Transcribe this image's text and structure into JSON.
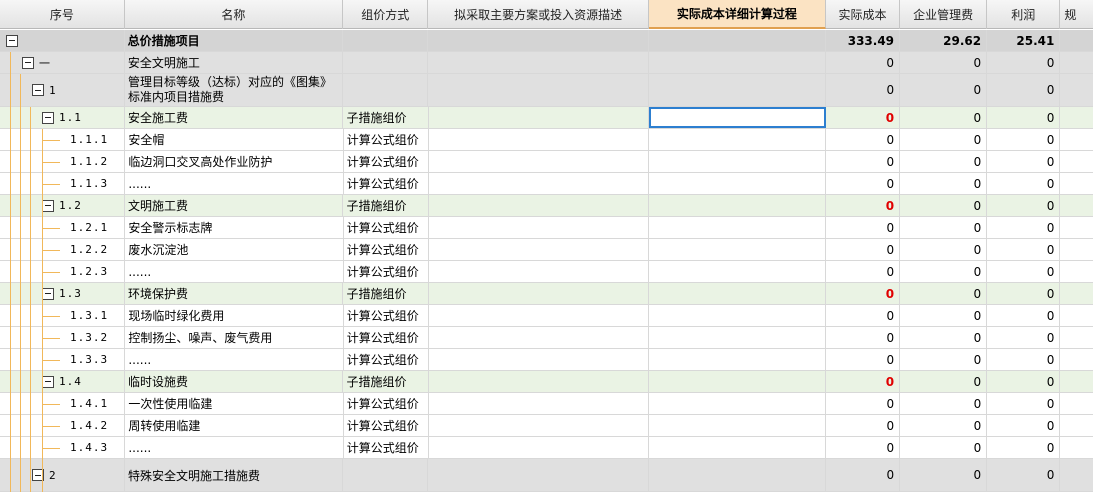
{
  "columns": [
    "序号",
    "名称",
    "组价方式",
    "拟采取主要方案或投入资源描述",
    "实际成本详细计算过程",
    "实际成本",
    "企业管理费",
    "利润",
    "规"
  ],
  "rows": [
    {
      "type": "total",
      "seq": "",
      "name": "总价措施项目",
      "method": "",
      "desc": "",
      "calc": "",
      "cost": "333.49",
      "mgmt": "29.62",
      "profit": "25.41"
    },
    {
      "type": "lvl1",
      "seq": "一",
      "name": "安全文明施工",
      "method": "",
      "desc": "",
      "calc": "",
      "cost": "0",
      "mgmt": "0",
      "profit": "0"
    },
    {
      "type": "lvl2",
      "seq": "1",
      "name": "管理目标等级（达标）对应的《图集》标准内项目措施费",
      "method": "",
      "desc": "",
      "calc": "",
      "cost": "0",
      "mgmt": "0",
      "profit": "0"
    },
    {
      "type": "sub",
      "seq": "1.1",
      "name": "安全施工费",
      "method": "子措施组价",
      "desc": "",
      "calc": "",
      "cost": "0",
      "mgmt": "0",
      "profit": "0"
    },
    {
      "type": "item",
      "seq": "1.1.1",
      "name": "安全帽",
      "method": "计算公式组价",
      "desc": "",
      "calc": "",
      "cost": "0",
      "mgmt": "0",
      "profit": "0"
    },
    {
      "type": "item",
      "seq": "1.1.2",
      "name": "临边洞口交叉高处作业防护",
      "method": "计算公式组价",
      "desc": "",
      "calc": "",
      "cost": "0",
      "mgmt": "0",
      "profit": "0"
    },
    {
      "type": "item",
      "seq": "1.1.3",
      "name": "......",
      "method": "计算公式组价",
      "desc": "",
      "calc": "",
      "cost": "0",
      "mgmt": "0",
      "profit": "0"
    },
    {
      "type": "sub",
      "seq": "1.2",
      "name": "文明施工费",
      "method": "子措施组价",
      "desc": "",
      "calc": "",
      "cost": "0",
      "mgmt": "0",
      "profit": "0"
    },
    {
      "type": "item",
      "seq": "1.2.1",
      "name": "安全警示标志牌",
      "method": "计算公式组价",
      "desc": "",
      "calc": "",
      "cost": "0",
      "mgmt": "0",
      "profit": "0"
    },
    {
      "type": "item",
      "seq": "1.2.2",
      "name": "废水沉淀池",
      "method": "计算公式组价",
      "desc": "",
      "calc": "",
      "cost": "0",
      "mgmt": "0",
      "profit": "0"
    },
    {
      "type": "item",
      "seq": "1.2.3",
      "name": "......",
      "method": "计算公式组价",
      "desc": "",
      "calc": "",
      "cost": "0",
      "mgmt": "0",
      "profit": "0"
    },
    {
      "type": "sub",
      "seq": "1.3",
      "name": "环境保护费",
      "method": "子措施组价",
      "desc": "",
      "calc": "",
      "cost": "0",
      "mgmt": "0",
      "profit": "0"
    },
    {
      "type": "item",
      "seq": "1.3.1",
      "name": "现场临时绿化费用",
      "method": "计算公式组价",
      "desc": "",
      "calc": "",
      "cost": "0",
      "mgmt": "0",
      "profit": "0"
    },
    {
      "type": "item",
      "seq": "1.3.2",
      "name": "控制扬尘、噪声、废气费用",
      "method": "计算公式组价",
      "desc": "",
      "calc": "",
      "cost": "0",
      "mgmt": "0",
      "profit": "0"
    },
    {
      "type": "item",
      "seq": "1.3.3",
      "name": "......",
      "method": "计算公式组价",
      "desc": "",
      "calc": "",
      "cost": "0",
      "mgmt": "0",
      "profit": "0"
    },
    {
      "type": "sub",
      "seq": "1.4",
      "name": "临时设施费",
      "method": "子措施组价",
      "desc": "",
      "calc": "",
      "cost": "0",
      "mgmt": "0",
      "profit": "0"
    },
    {
      "type": "item",
      "seq": "1.4.1",
      "name": "一次性使用临建",
      "method": "计算公式组价",
      "desc": "",
      "calc": "",
      "cost": "0",
      "mgmt": "0",
      "profit": "0"
    },
    {
      "type": "item",
      "seq": "1.4.2",
      "name": "周转使用临建",
      "method": "计算公式组价",
      "desc": "",
      "calc": "",
      "cost": "0",
      "mgmt": "0",
      "profit": "0"
    },
    {
      "type": "item",
      "seq": "1.4.3",
      "name": "......",
      "method": "计算公式组价",
      "desc": "",
      "calc": "",
      "cost": "0",
      "mgmt": "0",
      "profit": "0"
    },
    {
      "type": "lvl2",
      "seq": "2",
      "name": "特殊安全文明施工措施费",
      "method": "",
      "desc": "",
      "calc": "",
      "cost": "0",
      "mgmt": "0",
      "profit": "0"
    }
  ],
  "colors": {
    "sub_row_bg": "#eaf3e4",
    "group_row_bg": "#e0e0e0",
    "total_row_bg": "#d4d4d4",
    "active_header": "#fbe3c3",
    "red_value": "#e00000",
    "tree_line": "#f1b85a",
    "selection": "#2d7fd0"
  },
  "toggle_icon": "minus-square-icon",
  "selected_cell": {
    "row": "1.1",
    "column": "实际成本详细计算过程"
  }
}
